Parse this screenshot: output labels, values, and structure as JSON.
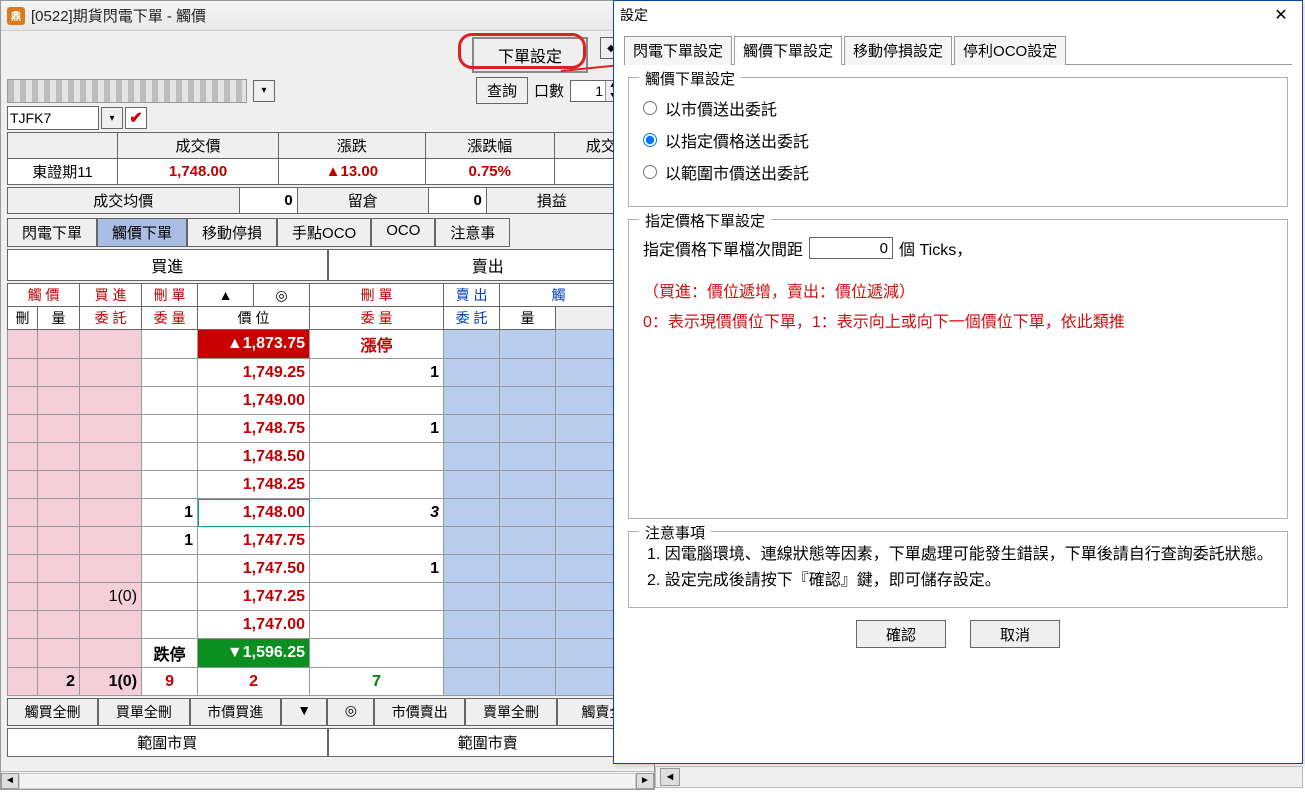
{
  "window": {
    "title": "[0522]期貨閃電下單 - 觸價"
  },
  "toolbar": {
    "settings_button": "下單設定",
    "query_button": "查詢",
    "qty_label": "口數",
    "qty_value": "1"
  },
  "symbol": {
    "code": "TJFK7",
    "name": "東證期11"
  },
  "quote_headers": {
    "price": "成交價",
    "change": "漲跌",
    "change_pct": "漲跌幅",
    "volume": "成交",
    "avg": "成交均價",
    "pos": "留倉",
    "pnl": "損益"
  },
  "quote": {
    "price": "1,748.00",
    "change": "▲13.00",
    "change_pct": "0.75%",
    "avg": "0",
    "pos": "0"
  },
  "tabs": {
    "flash": "閃電下單",
    "trigger": "觸價下單",
    "trail": "移動停損",
    "manual_oco": "手點OCO",
    "oco": "OCO",
    "notice": "注意事"
  },
  "bs": {
    "buy": "買進",
    "sell": "賣出"
  },
  "grid_headers": {
    "t_price": "觸 價",
    "t_del": "刪",
    "t_qty": "量",
    "buy": "買 進",
    "buy_order": "委 託",
    "del_order": "刪 單",
    "del_qty": "委 量",
    "up": "▲",
    "center": "◎",
    "price": "價 位",
    "sell": "賣 出",
    "sell_order": "委 託",
    "s_trigger": "觸",
    "s_qty": "量"
  },
  "ladder": [
    {
      "price": "▲1,873.75",
      "limit_up": true,
      "limit_label": "漲停"
    },
    {
      "price": "1,749.25",
      "ask": "1"
    },
    {
      "price": "1,749.00"
    },
    {
      "price": "1,748.75",
      "ask": "1"
    },
    {
      "price": "1,748.50"
    },
    {
      "price": "1,748.25"
    },
    {
      "price": "1,748.00",
      "bid": "1",
      "ask": "3",
      "is_last": true
    },
    {
      "price": "1,747.75",
      "bid": "1"
    },
    {
      "price": "1,747.50",
      "ask": "1"
    },
    {
      "price": "1,747.25",
      "buy_order": "1(0)"
    },
    {
      "price": "1,747.00"
    },
    {
      "price": "▼1,596.25",
      "limit_down": true,
      "dn_label": "跌停"
    }
  ],
  "totals": {
    "t_qty": "2",
    "buy_order": "1(0)",
    "del_qty": "9",
    "center": "2",
    "ask": "7"
  },
  "footer": {
    "b1": "觸買全刪",
    "b2": "買單全刪",
    "b3": "市價買進",
    "b4": "▼",
    "b5": "◎",
    "b6": "市價賣出",
    "b7": "賣單全刪",
    "b8": "觸賣全",
    "range_buy": "範圍市買",
    "range_sell": "範圍市賣"
  },
  "dialog": {
    "title": "設定",
    "tabs": {
      "flash": "閃電下單設定",
      "trigger": "觸價下單設定",
      "trail": "移動停損設定",
      "oco": "停利OCO設定"
    },
    "group1_title": "觸價下單設定",
    "opt_market": "以市價送出委託",
    "opt_limit": "以指定價格送出委託",
    "opt_range": "以範圍市價送出委託",
    "group2_title": "指定價格下單設定",
    "ticks_label_pre": "指定價格下單檔次間距",
    "ticks_value": "0",
    "ticks_label_post": "個 Ticks，",
    "hint1": "（買進：價位遞增，賣出：價位遞減）",
    "hint2": "0：表示現價價位下單，1：表示向上或向下一個價位下單，依此類推",
    "group3_title": "注意事項",
    "note1": "1. 因電腦環境、連線狀態等因素，下單處理可能發生錯誤，下單後請自行查詢委託狀態。",
    "note2": "2. 設定完成後請按下『確認』鍵，即可儲存設定。",
    "ok": "確認",
    "cancel": "取消"
  }
}
